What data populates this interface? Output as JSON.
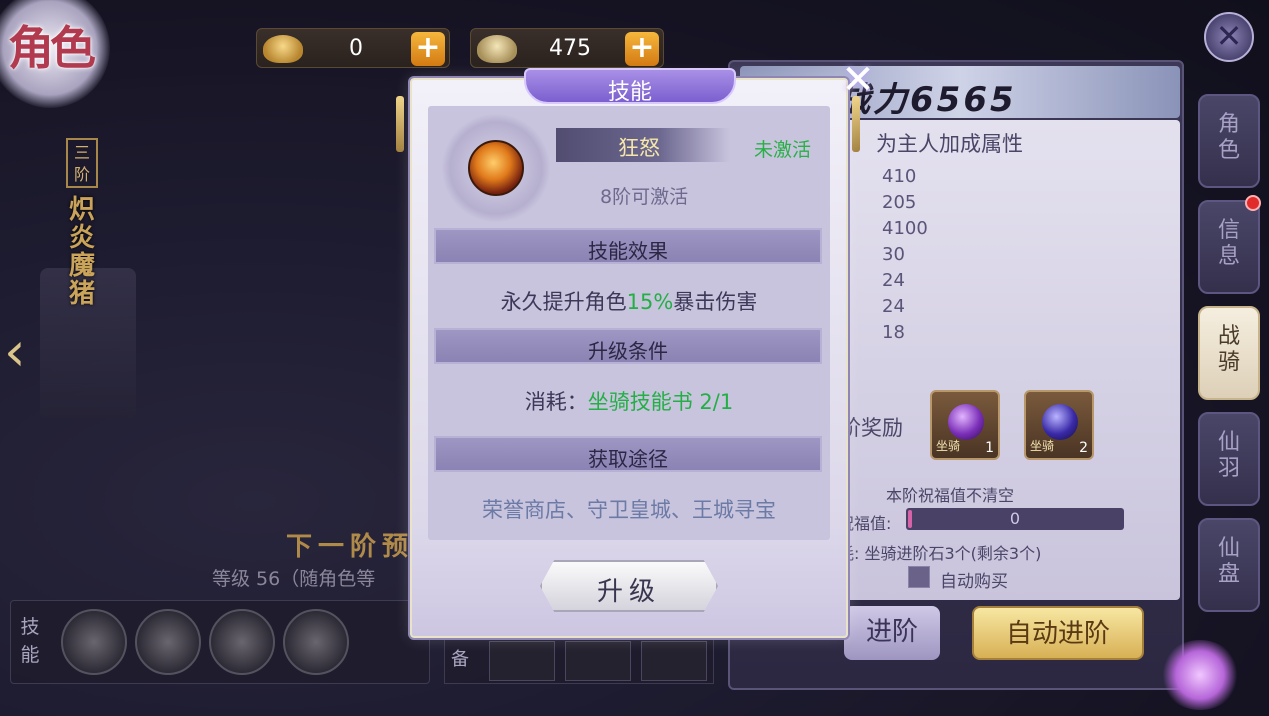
{
  "header": {
    "title": "角色",
    "currencies": [
      {
        "icon": "gold-ingot-icon",
        "value": "0"
      },
      {
        "icon": "silver-ingot-icon",
        "value": "475"
      }
    ],
    "plus_glyph": "+",
    "close_glyph": "✕"
  },
  "left": {
    "rank": "三阶",
    "mount_name": "炽炎魔猪",
    "arrow_glyph": "‹",
    "next_title": "下一阶预",
    "level_text": "等级  56（随角色等",
    "skills_label": "技能",
    "equip_label": "备"
  },
  "right_panel": {
    "power": "战力6565",
    "attr_head": "为主人加成属性",
    "attr_values": [
      "410",
      "205",
      "4100",
      "30",
      "24",
      "24",
      "18"
    ],
    "reward_label": "阶奖励",
    "rewards": [
      {
        "tag": "坐骑",
        "count": "1"
      },
      {
        "tag": "坐骑",
        "count": "2"
      }
    ],
    "bless_title": "本阶祝福值不清空",
    "bless_label": "祝福值:",
    "bless_value": "0",
    "bless_fraction": 0.02,
    "cost_text": "耗: 坐骑进阶石3个(剩余3个)",
    "auto_buy": "自动购买",
    "advance_btn": "进阶",
    "auto_advance_btn": "自动进阶"
  },
  "tabs": [
    {
      "label": "角\n色"
    },
    {
      "label": "信\n息"
    },
    {
      "label": "战\n骑"
    },
    {
      "label": "仙\n羽"
    },
    {
      "label": "仙\n盘"
    }
  ],
  "dialog": {
    "title": "技能",
    "close_glyph": "✕",
    "skill_name": "狂怒",
    "status": "未激活",
    "activate_condition": "8阶可激活",
    "effect_title": "技能效果",
    "effect_prefix": "永久提升角色",
    "effect_value": "15%",
    "effect_suffix": "暴击伤害",
    "upgrade_title": "升级条件",
    "cost_prefix": "消耗：",
    "cost_value": "坐骑技能书 2/1",
    "source_title": "获取途径",
    "source_text": "荣誉商店、守卫皇城、王城寻宝",
    "upgrade_button": "升级"
  },
  "colors": {
    "accent_green": "#22b044",
    "dialog_header": "#7b5fcf",
    "gold_button": "#d8b055"
  }
}
